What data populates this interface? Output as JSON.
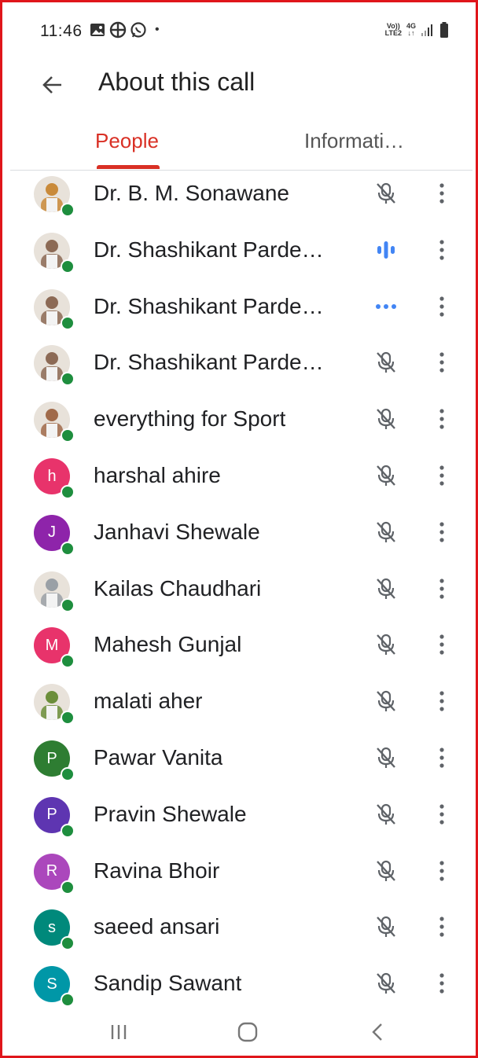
{
  "status_bar": {
    "time": "11:46",
    "dot": "•",
    "volte_top": "Vo))",
    "volte_bottom": "LTE2",
    "net_top": "4G",
    "net_bottom": "↓↑"
  },
  "header": {
    "title": "About this call"
  },
  "tabs": [
    {
      "label": "People",
      "active": true
    },
    {
      "label": "Informati…",
      "active": false
    }
  ],
  "participants": [
    {
      "name": "Dr. B. M. Sonawane",
      "avatar_type": "photo",
      "photo_color": "#c98a3a",
      "mic": "muted"
    },
    {
      "name": "Dr. Shashikant Parde…",
      "avatar_type": "photo",
      "photo_color": "#8c6a55",
      "mic": "speaking"
    },
    {
      "name": "Dr. Shashikant Parde…",
      "avatar_type": "photo",
      "photo_color": "#8c6a55",
      "mic": "connecting"
    },
    {
      "name": "Dr. Shashikant Parde…",
      "avatar_type": "photo",
      "photo_color": "#8c6a55",
      "mic": "muted"
    },
    {
      "name": "everything for Sport",
      "avatar_type": "photo",
      "photo_color": "#a06a4a",
      "mic": "muted"
    },
    {
      "name": "harshal ahire",
      "avatar_type": "initial",
      "initial": "h",
      "color": "#e8336b",
      "mic": "muted"
    },
    {
      "name": "Janhavi Shewale",
      "avatar_type": "initial",
      "initial": "J",
      "color": "#8e24aa",
      "mic": "muted"
    },
    {
      "name": "Kailas Chaudhari",
      "avatar_type": "photo",
      "photo_color": "#9aa0a6",
      "mic": "muted"
    },
    {
      "name": "Mahesh Gunjal",
      "avatar_type": "initial",
      "initial": "M",
      "color": "#e8336b",
      "mic": "muted"
    },
    {
      "name": "malati aher",
      "avatar_type": "photo",
      "photo_color": "#6b8e3a",
      "mic": "muted"
    },
    {
      "name": "Pawar Vanita",
      "avatar_type": "initial",
      "initial": "P",
      "color": "#2e7d32",
      "mic": "muted"
    },
    {
      "name": "Pravin Shewale",
      "avatar_type": "initial",
      "initial": "P",
      "color": "#5e35b1",
      "mic": "muted"
    },
    {
      "name": "Ravina Bhoir",
      "avatar_type": "initial",
      "initial": "R",
      "color": "#ab47bc",
      "mic": "muted"
    },
    {
      "name": "saeed ansari",
      "avatar_type": "initial",
      "initial": "s",
      "color": "#00897b",
      "mic": "muted"
    },
    {
      "name": "Sandip Sawant",
      "avatar_type": "initial",
      "initial": "S",
      "color": "#0097a7",
      "mic": "muted"
    }
  ],
  "colors": {
    "accent": "#d93025",
    "speaking": "#4285f4",
    "online": "#1e8e3e",
    "icon_gray": "#5f6368"
  },
  "icons": {
    "back": "arrow-left-icon",
    "muted": "mic-off-icon",
    "speaking": "audio-level-icon",
    "connecting": "dots-horizontal-icon",
    "more": "more-vertical-icon"
  }
}
